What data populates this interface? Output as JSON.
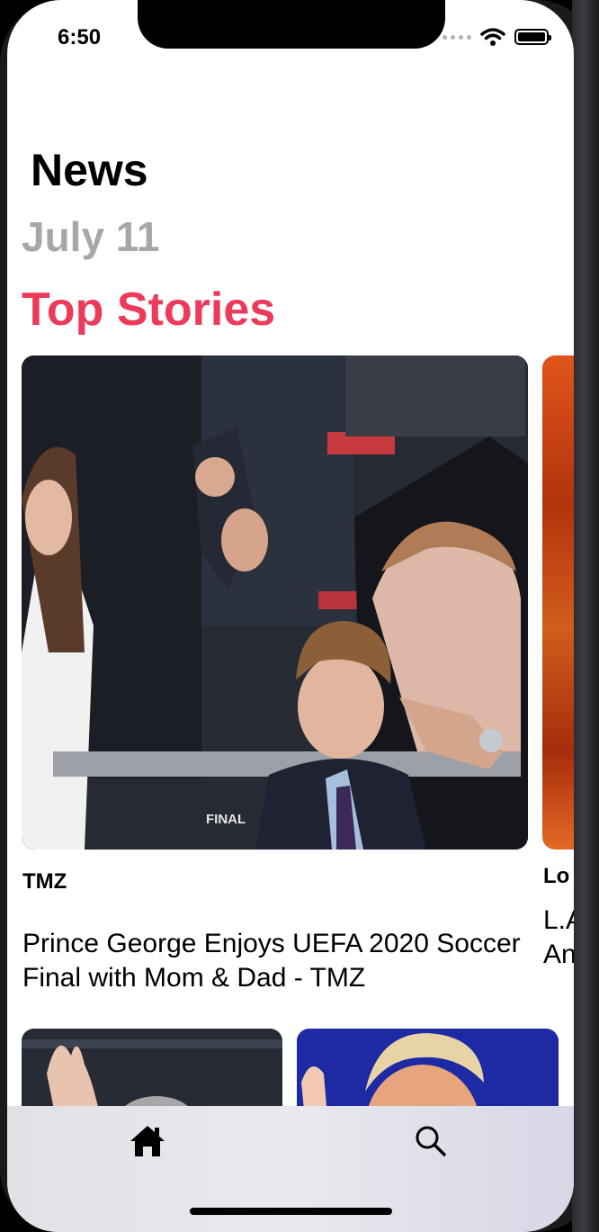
{
  "status_bar": {
    "time": "6:50"
  },
  "header": {
    "title": "News",
    "date": "July 11",
    "section_title": "Top Stories"
  },
  "top_stories": [
    {
      "source": "TMZ",
      "headline": "Prince George Enjoys UEFA 2020 Soccer Final with Mom & Dad - TMZ"
    },
    {
      "source": "Lo",
      "headline": "L.A co An"
    }
  ],
  "tab_bar": {
    "items": [
      {
        "icon": "home-icon"
      },
      {
        "icon": "search-icon"
      }
    ]
  },
  "colors": {
    "accent": "#ec3a5a",
    "date_gray": "#a7a7ab"
  }
}
